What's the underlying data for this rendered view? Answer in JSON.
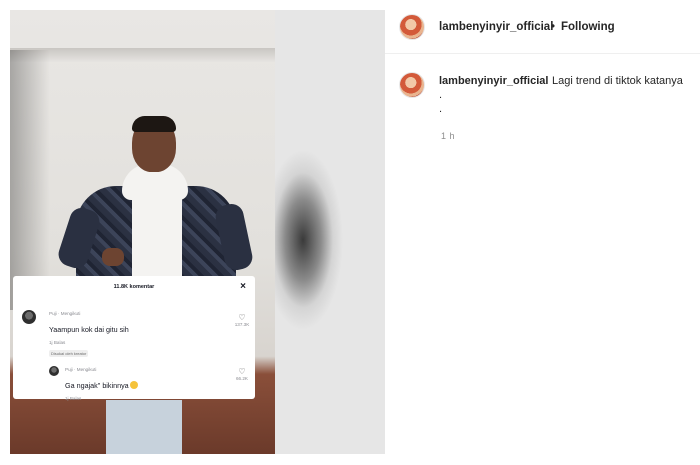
{
  "post": {
    "username": "lambenyinyir_official",
    "separator": "•",
    "follow_status": "Following",
    "caption_text": "Lagi trend di tiktok katanya",
    "caption_dots": [
      ".",
      "."
    ],
    "time_ago": "1 h"
  },
  "tiktok_comments": {
    "count_label": "11.8K komentar",
    "close_icon": "×",
    "items": [
      {
        "user": "Puji · Mengikuti",
        "text": "Yaampun kok dai gitu sih",
        "meta": "1j   Balas",
        "tag": "Disukai oleh kreator",
        "likes": "137.3K"
      },
      {
        "user": "Puji · Mengikuti",
        "text": "Ga ngajak\" bikinnya",
        "meta": "1j   Balas",
        "likes": "66.2K"
      }
    ]
  },
  "colors": {
    "text_primary": "#262626",
    "text_secondary": "#8e8e8e",
    "divider": "#efefef"
  }
}
